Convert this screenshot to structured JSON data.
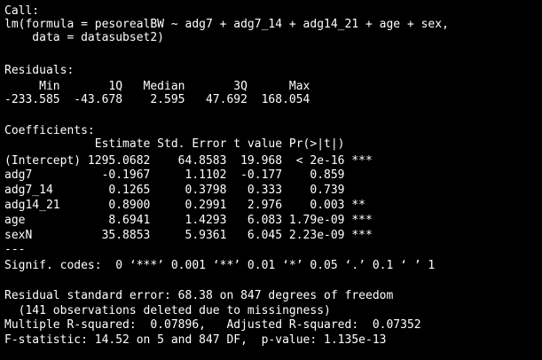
{
  "console": {
    "text_color": "#ffffff",
    "background_color": "#000000",
    "lines": [
      "Call:",
      "lm(formula = pesorealBW ~ adg7 + adg7_14 + adg14_21 + age + sex,",
      "    data = datasubset2)",
      "",
      "Residuals:",
      "     Min       1Q   Median       3Q      Max ",
      "-233.585  -43.678    2.595   47.692  168.054 ",
      "",
      "Coefficients:",
      "             Estimate Std. Error t value Pr(>|t|)    ",
      "(Intercept) 1295.0682    64.8583  19.968  < 2e-16 ***",
      "adg7          -0.1967     1.1102  -0.177    0.859    ",
      "adg7_14        0.1265     0.3798   0.333    0.739    ",
      "adg14_21       0.8900     0.2991   2.976    0.003 ** ",
      "age            8.6941     1.4293   6.083 1.79e-09 ***",
      "sexN          35.8853     5.9361   6.045 2.23e-09 ***",
      "---",
      "Signif. codes:  0 ‘***’ 0.001 ‘**’ 0.01 ‘*’ 0.05 ‘.’ 0.1 ‘ ’ 1",
      "",
      "Residual standard error: 68.38 on 847 degrees of freedom",
      "  (141 observations deleted due to missingness)",
      "Multiple R-squared:  0.07896,\tAdjusted R-squared:  0.07352 ",
      "F-statistic: 14.52 on 5 and 847 DF,  p-value: 1.135e-13"
    ]
  }
}
